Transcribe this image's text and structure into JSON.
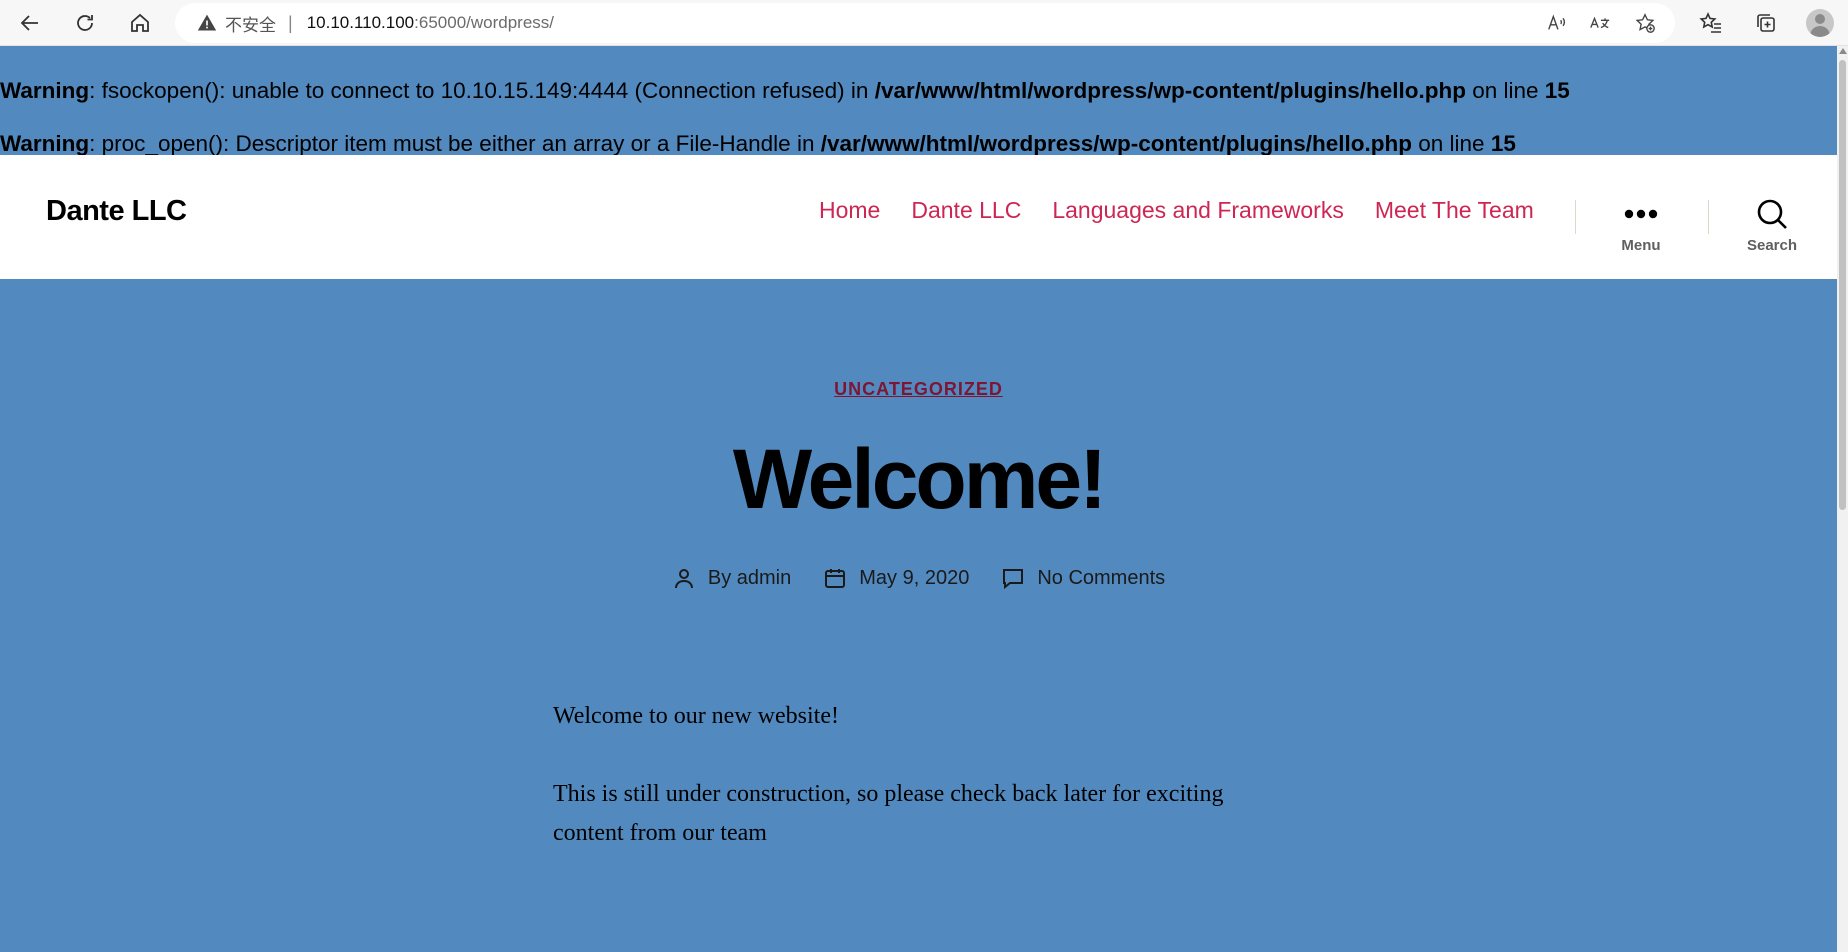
{
  "browser": {
    "insecure_label": "不安全",
    "separator": "|",
    "url_host": "10.10.110.100",
    "url_rest": ":65000/wordpress/"
  },
  "php_warnings": [
    {
      "label": "Warning",
      "message": ": fsockopen(): unable to connect to 10.10.15.149:4444 (Connection refused) in ",
      "path": "/var/www/html/wordpress/wp-content/plugins/hello.php",
      "on_line": " on line ",
      "line": "15"
    },
    {
      "label": "Warning",
      "message": ": proc_open(): Descriptor item must be either an array or a File-Handle in ",
      "path": "/var/www/html/wordpress/wp-content/plugins/hello.php",
      "on_line": " on line ",
      "line": "15"
    }
  ],
  "header": {
    "site_title": "Dante LLC",
    "menu": [
      "Home",
      "Dante LLC",
      "Languages and Frameworks",
      "Meet The Team"
    ],
    "menu_toggle_label": "Menu",
    "search_toggle_label": "Search"
  },
  "post": {
    "category": "UNCATEGORIZED",
    "title": "Welcome!",
    "author_prefix": "By ",
    "author": "admin",
    "date": "May 9, 2020",
    "comments": "No Comments",
    "paragraphs": [
      "Welcome to our new website!",
      "This is still under construction, so please check back later for exciting content from our team"
    ]
  },
  "colors": {
    "page_background": "#528ac0",
    "menu_link": "#cd2653",
    "category_link": "#7c1634"
  }
}
